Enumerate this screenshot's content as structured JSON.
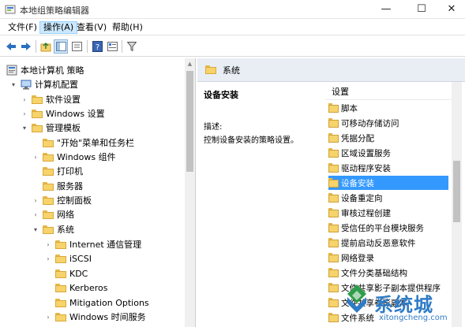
{
  "window": {
    "title": "本地组策略编辑器",
    "minimize": "—",
    "maximize": "☐",
    "close": "✕"
  },
  "menubar": {
    "items": [
      {
        "label": "文件(F)"
      },
      {
        "label": "操作(A)"
      },
      {
        "label": "查看(V)"
      },
      {
        "label": "帮助(H)"
      }
    ],
    "selected": "操作(A)"
  },
  "toolbar": {
    "buttons": [
      "back-icon",
      "forward-icon",
      "up-folder-icon",
      "show-hide-tree-icon",
      "export-list-icon",
      "help-icon",
      "properties-icon",
      "filter-icon"
    ],
    "active": "show-hide-tree-icon"
  },
  "tree": {
    "items": [
      {
        "label": "本地计算机 策略",
        "level": 0,
        "expander": "",
        "icon": "policy-icon"
      },
      {
        "label": "计算机配置",
        "level": 1,
        "expander": "▾",
        "icon": "computer-icon"
      },
      {
        "label": "软件设置",
        "level": 2,
        "expander": "›",
        "icon": "folder-icon"
      },
      {
        "label": "Windows 设置",
        "level": 2,
        "expander": "›",
        "icon": "folder-icon"
      },
      {
        "label": "管理模板",
        "level": 2,
        "expander": "▾",
        "icon": "folder-icon"
      },
      {
        "label": "\"开始\"菜单和任务栏",
        "level": 3,
        "expander": "",
        "icon": "folder-icon"
      },
      {
        "label": "Windows 组件",
        "level": 3,
        "expander": "›",
        "icon": "folder-icon"
      },
      {
        "label": "打印机",
        "level": 3,
        "expander": "",
        "icon": "folder-icon"
      },
      {
        "label": "服务器",
        "level": 3,
        "expander": "",
        "icon": "folder-icon"
      },
      {
        "label": "控制面板",
        "level": 3,
        "expander": "›",
        "icon": "folder-icon"
      },
      {
        "label": "网络",
        "level": 3,
        "expander": "›",
        "icon": "folder-icon"
      },
      {
        "label": "系统",
        "level": 3,
        "expander": "▾",
        "icon": "folder-icon"
      },
      {
        "label": "Internet 通信管理",
        "level": 4,
        "expander": "›",
        "icon": "folder-icon"
      },
      {
        "label": "iSCSI",
        "level": 4,
        "expander": "›",
        "icon": "folder-icon"
      },
      {
        "label": "KDC",
        "level": 4,
        "expander": "",
        "icon": "folder-icon"
      },
      {
        "label": "Kerberos",
        "level": 4,
        "expander": "",
        "icon": "folder-icon"
      },
      {
        "label": "Mitigation Options",
        "level": 4,
        "expander": "",
        "icon": "folder-icon"
      },
      {
        "label": "Windows 时间服务",
        "level": 4,
        "expander": "›",
        "icon": "folder-icon"
      }
    ]
  },
  "right_pane": {
    "header": "系统",
    "description": {
      "title": "设备安装",
      "key": "描述:",
      "value": "控制设备安装的策略设置。"
    },
    "list": {
      "column_header": "设置",
      "items": [
        "脚本",
        "可移动存储访问",
        "凭据分配",
        "区域设置服务",
        "驱动程序安装",
        "设备安装",
        "设备重定向",
        "审核过程创建",
        "受信任的平台模块服务",
        "提前启动反恶意软件",
        "网络登录",
        "文件分类基础结构",
        "文件共享影子副本提供程序",
        "文件共享卷影副本",
        "文件系统"
      ],
      "selected": "设备安装"
    }
  },
  "watermark": {
    "text": "系统城",
    "url": "xitongcheng.com"
  },
  "colors": {
    "selection": "#3399ff",
    "menu_selected": "#cce8ff",
    "folder": "#f6d36b",
    "header_bg": "#e9eef5"
  }
}
